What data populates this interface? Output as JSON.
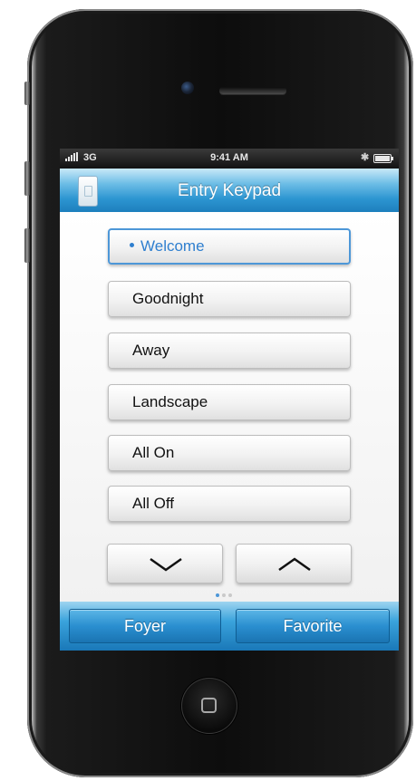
{
  "status_bar": {
    "carrier": "3G",
    "time": "9:41 AM",
    "bluetooth_glyph": "✱"
  },
  "nav": {
    "title": "Entry Keypad",
    "icon": "keypad-icon"
  },
  "scenes": [
    {
      "label": "Welcome",
      "selected": true
    },
    {
      "label": "Goodnight",
      "selected": false
    },
    {
      "label": "Away",
      "selected": false
    },
    {
      "label": "Landscape",
      "selected": false
    },
    {
      "label": "All On",
      "selected": false
    },
    {
      "label": "All Off",
      "selected": false
    }
  ],
  "arrows": {
    "down_icon": "chevron-down-icon",
    "up_icon": "chevron-up-icon"
  },
  "page_indicator": {
    "pages": 3,
    "current": 1
  },
  "tabs": {
    "left": "Foyer",
    "right": "Favorite"
  },
  "colors": {
    "accent": "#2f7fcf",
    "nav_blue": "#2c95d1",
    "selected_border": "#4d97d8"
  }
}
